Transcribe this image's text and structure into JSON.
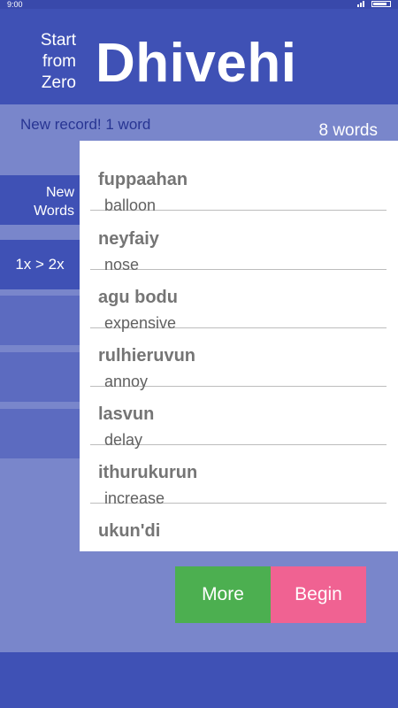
{
  "status_bar": {
    "time": "9:00"
  },
  "header": {
    "logo_line1": "Start",
    "logo_line2": "from",
    "logo_line3": "Zero",
    "title": "Dhivehi"
  },
  "info": {
    "record": "New record! 1 word",
    "count": "8 words"
  },
  "sidebar": {
    "new_words_line1": "New",
    "new_words_line2": "Words",
    "mode": "1x > 2x"
  },
  "words": [
    {
      "term": "fuppaahan",
      "meaning": "balloon"
    },
    {
      "term": "neyfaiy",
      "meaning": "nose"
    },
    {
      "term": "agu bodu",
      "meaning": "expensive"
    },
    {
      "term": "rulhieruvun",
      "meaning": "annoy"
    },
    {
      "term": "lasvun",
      "meaning": "delay"
    },
    {
      "term": "ithurukurun",
      "meaning": "increase"
    },
    {
      "term": "ukun'di",
      "meaning": ""
    }
  ],
  "buttons": {
    "more": "More",
    "begin": "Begin"
  },
  "colors": {
    "primary": "#3f51b5",
    "background": "#7986cb",
    "more": "#4caf50",
    "begin": "#f06292"
  }
}
